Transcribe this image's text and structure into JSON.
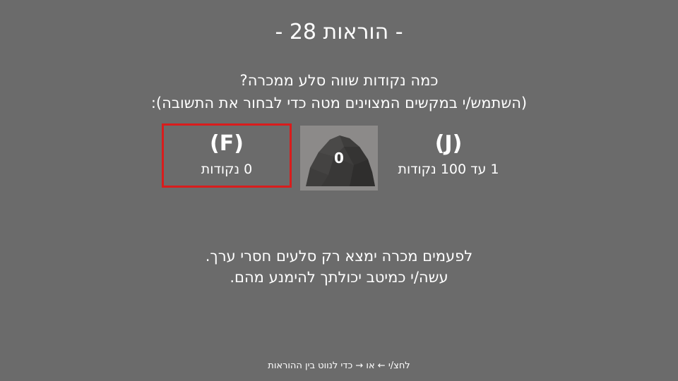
{
  "title": "- הוראות 28 -",
  "question": {
    "line1": "כמה נקודות שווה סלע ממכרה?",
    "line2": "(השתמש/י במקשים המצוינים מטה כדי לבחור את התשובה):"
  },
  "options": {
    "left": {
      "key": "(F)",
      "text": "0 נקודות",
      "selected": true
    },
    "right": {
      "key": "(J)",
      "text": "1 עד 100 נקודות",
      "selected": false
    }
  },
  "rock": {
    "value": "0",
    "icon": "rock-image"
  },
  "warning": {
    "line1": "לפעמים מכרה ימצא רק סלעים חסרי ערך.",
    "line2": "עשה/י כמיטב יכולתך להימנע מהם."
  },
  "footer": "לחצ/י ← או → כדי לנווט בין ההוראות",
  "colors": {
    "background": "#6b6b6b",
    "selection_border": "#d91c1c",
    "text": "#ffffff"
  }
}
